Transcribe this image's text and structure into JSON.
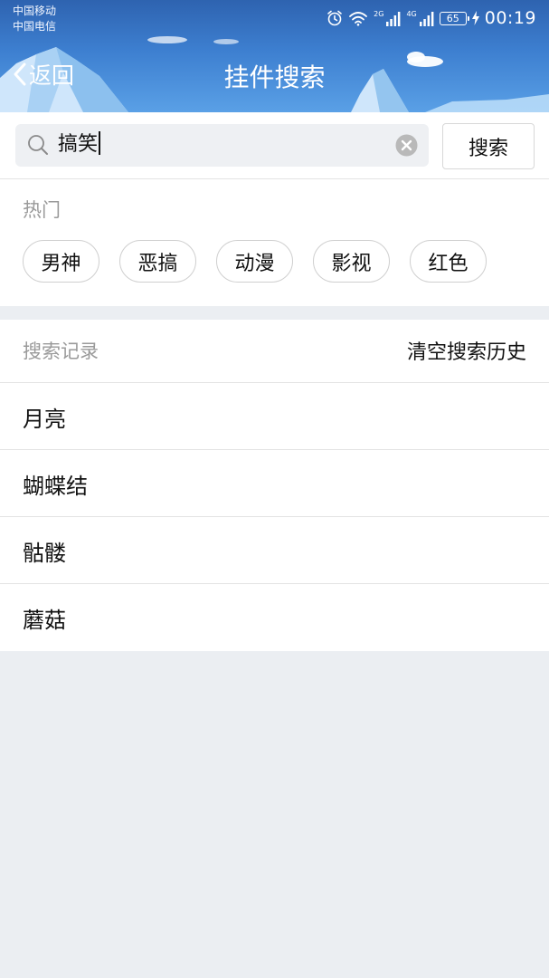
{
  "status_bar": {
    "carrier_1": "中国移动",
    "carrier_2": "中国电信",
    "net_2g": "2G",
    "net_4g": "4G",
    "battery": "65",
    "time": "00:19"
  },
  "nav": {
    "back_label": "返回",
    "title": "挂件搜索"
  },
  "search": {
    "query": "搞笑",
    "button_label": "搜索"
  },
  "hot": {
    "label": "热门",
    "tags": [
      "男神",
      "恶搞",
      "动漫",
      "影视",
      "红色"
    ]
  },
  "history": {
    "label": "搜索记录",
    "clear_label": "清空搜索历史",
    "items": [
      "月亮",
      "蝴蝶结",
      "骷髅",
      "蘑菇"
    ]
  },
  "colors": {
    "header_top": "#2e63b0",
    "header_bottom": "#5aa0e6",
    "page_background": "#ebeef2",
    "muted_text": "#9a9a9a"
  }
}
